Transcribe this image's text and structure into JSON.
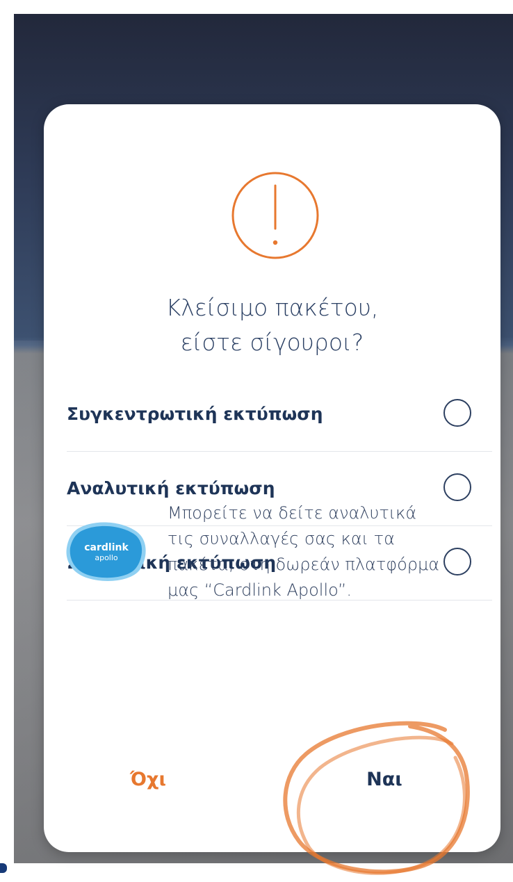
{
  "dialog": {
    "icon": "exclamation-circle-icon",
    "title_line1": "Κλείσιμο πακέτου,",
    "title_line2": "είστε σίγουροι?",
    "options": [
      {
        "label": "Συγκεντρωτική εκτύπωση",
        "selected": false
      },
      {
        "label": "Αναλυτική εκτύπωση",
        "selected": false
      },
      {
        "label": "Συνοπτική εκτύπωση",
        "selected": false
      }
    ],
    "promo": {
      "logo_text": "cardlink",
      "logo_subtext": "apollo",
      "lines": [
        "Μπορείτε να δείτε αναλυτικά",
        "τις συναλλαγές σας και τα",
        "πακέτα, στη δωρεάν πλατφόρμα",
        "μας “Cardlink Apollo”."
      ]
    },
    "buttons": {
      "no_label": "Όχι",
      "yes_label": "Ναι"
    }
  },
  "colors": {
    "accent_orange": "#e7782f",
    "text_navy": "#1e3457",
    "logo_blue": "#2b9ad9"
  }
}
